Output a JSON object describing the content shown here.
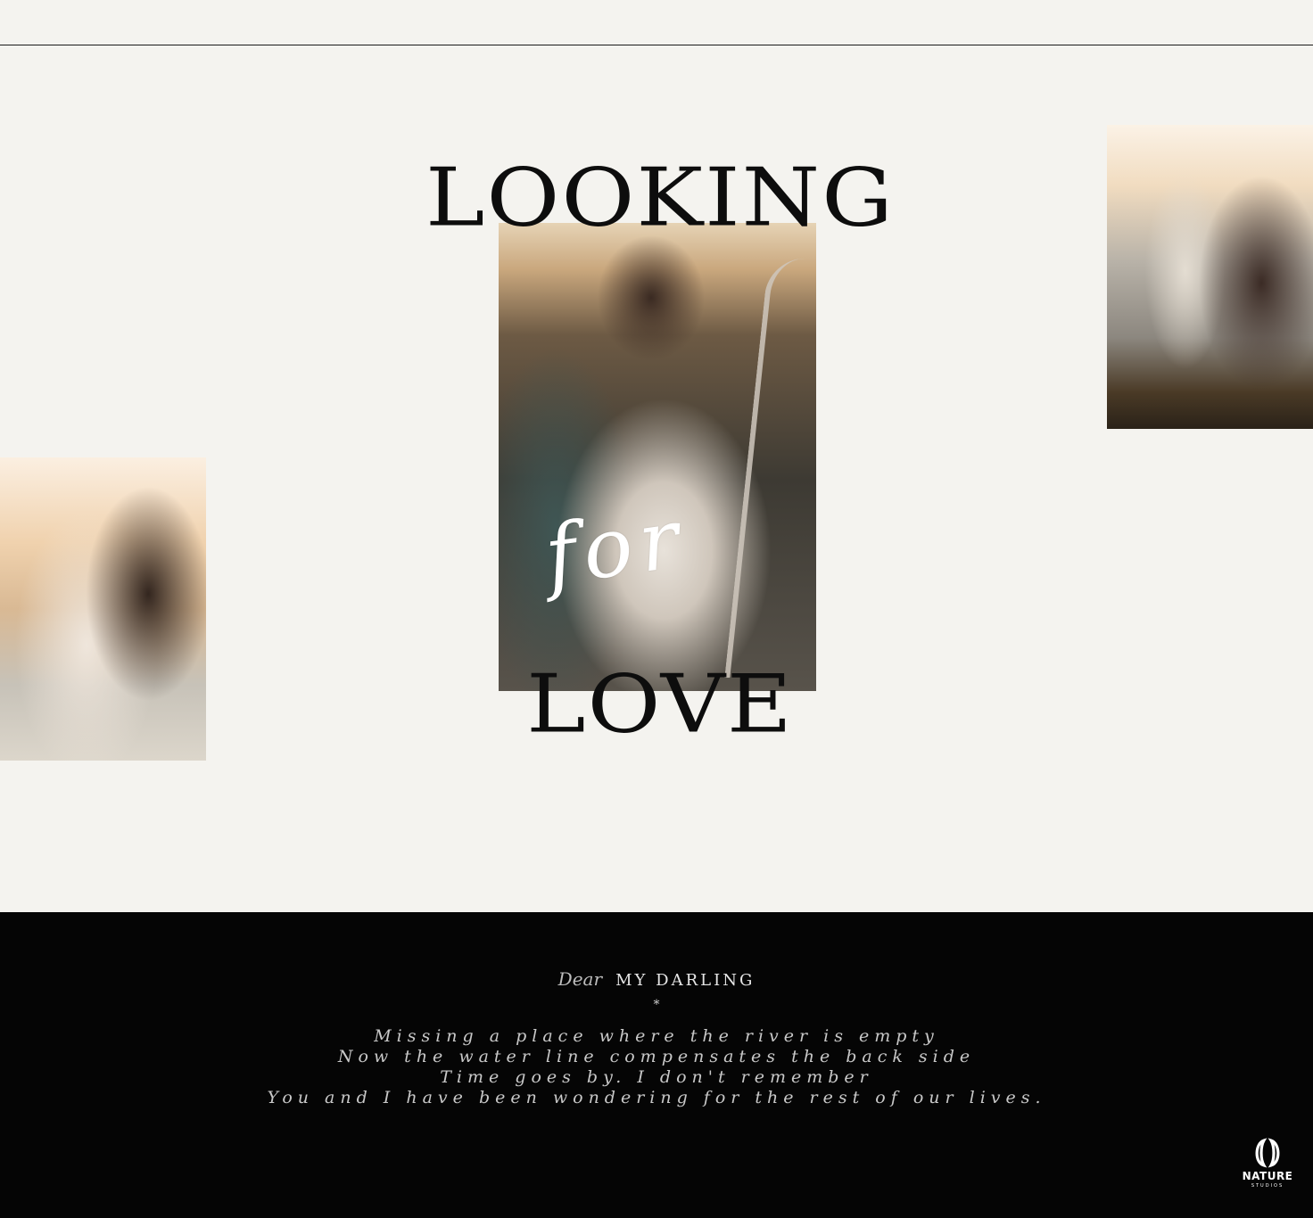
{
  "headline": {
    "top": "LOOKING",
    "middle": "for",
    "bottom": "LOVE"
  },
  "letter": {
    "dear": "Dear",
    "name": "MY DARLING",
    "divider": "*",
    "lines": [
      "Missing a place where the river is empty",
      "Now the water line compensates the back side",
      "Time goes by. I don't remember",
      "You and I have been wondering for the rest of our lives."
    ]
  },
  "brand": {
    "name": "NATURE",
    "tagline": "STUDIOS"
  },
  "colors": {
    "background": "#f4f3ef",
    "ink": "#0d0d0d",
    "letter_bg": "#050505"
  }
}
